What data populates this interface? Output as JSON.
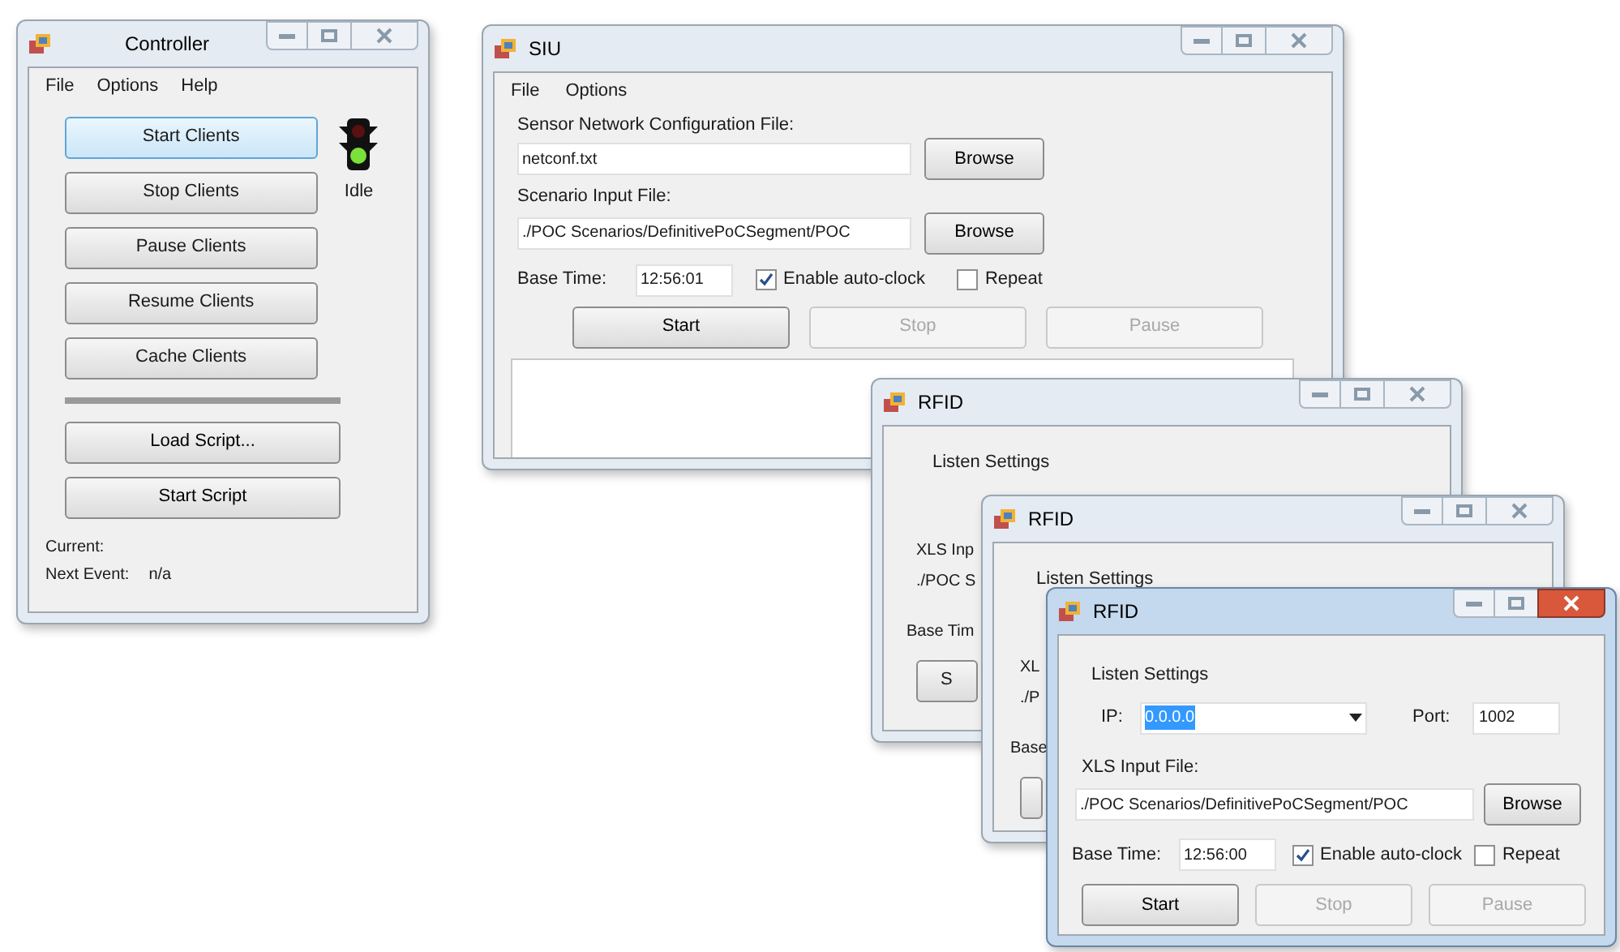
{
  "controller": {
    "title": "Controller",
    "active": false,
    "menu": [
      "File",
      "Options",
      "Help"
    ],
    "client_buttons": [
      {
        "label": "Start Clients",
        "focused": true
      },
      {
        "label": "Stop Clients",
        "focused": false
      },
      {
        "label": "Pause Clients",
        "focused": false
      },
      {
        "label": "Resume Clients",
        "focused": false
      },
      {
        "label": "Cache Clients",
        "focused": false
      }
    ],
    "status": "Idle",
    "script_buttons": [
      "Load Script...",
      "Start Script"
    ],
    "current_label": "Current:",
    "next_event_label": "Next Event:",
    "next_event_value": "n/a"
  },
  "siu": {
    "title": "SIU",
    "active": false,
    "menu": [
      "File",
      "Options"
    ],
    "config_label": "Sensor Network Configuration File:",
    "config_value": "netconf.txt",
    "config_browse": "Browse",
    "scenario_label": "Scenario Input File:",
    "scenario_value": "./POC Scenarios/DefinitivePoCSegment/POC",
    "scenario_browse": "Browse",
    "base_time_label": "Base Time:",
    "base_time_value": "12:56:01",
    "auto_clock": {
      "label": "Enable auto-clock",
      "checked": true
    },
    "repeat": {
      "label": "Repeat",
      "checked": false
    },
    "buttons": [
      {
        "label": "Start",
        "disabled": false
      },
      {
        "label": "Stop",
        "disabled": true
      },
      {
        "label": "Pause",
        "disabled": true
      }
    ]
  },
  "rfid_back": [
    {
      "title": "RFID",
      "active": false,
      "listen_settings": "Listen Settings",
      "xls_label": "XLS Inp",
      "xls_value": "./POC S",
      "base_time_label": "Base Tim",
      "button_label": "S"
    },
    {
      "title": "RFID",
      "active": false,
      "listen_settings": "Listen Settings",
      "xls_label": "XL",
      "xls_value": "./P",
      "base_time_label": "Base"
    }
  ],
  "rfid": {
    "title": "RFID",
    "active": true,
    "listen_settings": "Listen Settings",
    "ip_label": "IP:",
    "ip_value": "0.0.0.0",
    "ip_highlighted": true,
    "port_label": "Port:",
    "port_value": "1002",
    "xls_label": "XLS Input File:",
    "xls_value": "./POC Scenarios/DefinitivePoCSegment/POC",
    "browse": "Browse",
    "base_time_label": "Base Time:",
    "base_time_value": "12:56:00",
    "auto_clock": {
      "label": "Enable auto-clock",
      "checked": true
    },
    "repeat": {
      "label": "Repeat",
      "checked": false
    },
    "buttons": [
      {
        "label": "Start",
        "disabled": false
      },
      {
        "label": "Stop",
        "disabled": true
      },
      {
        "label": "Pause",
        "disabled": true
      }
    ]
  }
}
